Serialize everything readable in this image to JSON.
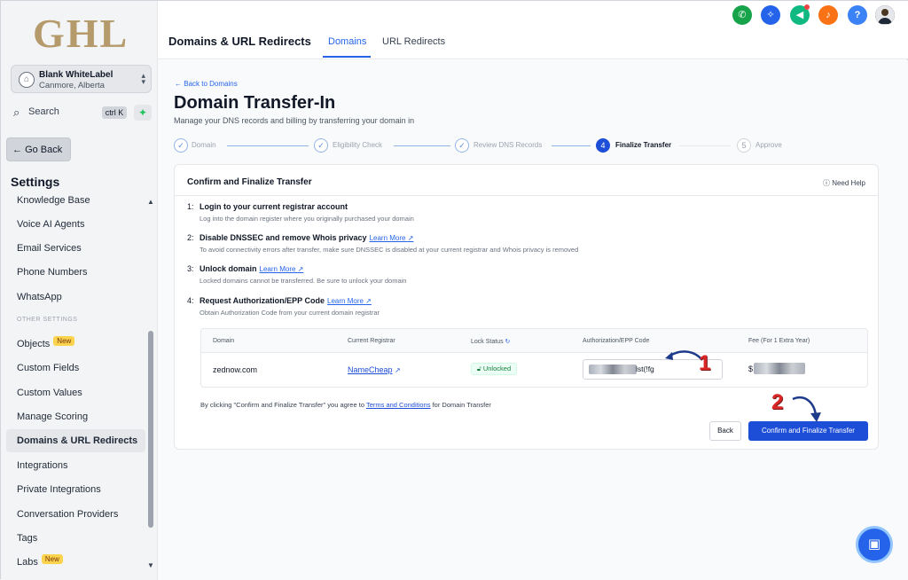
{
  "logo": "GHL",
  "account": {
    "name": "Blank WhiteLabel",
    "location": "Canmore, Alberta"
  },
  "search": {
    "label": "Search",
    "shortcut": "ctrl K"
  },
  "go_back": "Go Back",
  "settings_title": "Settings",
  "nav": {
    "items": [
      {
        "label": "Knowledge Base"
      },
      {
        "label": "Voice AI Agents"
      },
      {
        "label": "Email Services"
      },
      {
        "label": "Phone Numbers"
      },
      {
        "label": "WhatsApp"
      },
      {
        "label": "Objects",
        "badge": "New"
      },
      {
        "label": "Custom Fields"
      },
      {
        "label": "Custom Values"
      },
      {
        "label": "Manage Scoring"
      },
      {
        "label": "Domains & URL Redirects",
        "active": true
      },
      {
        "label": "Integrations"
      },
      {
        "label": "Private Integrations"
      },
      {
        "label": "Conversation Providers"
      },
      {
        "label": "Tags"
      },
      {
        "label": "Labs",
        "badge": "New"
      }
    ],
    "section_other": "OTHER SETTINGS"
  },
  "header": {
    "title": "Domains & URL Redirects",
    "tabs": [
      {
        "label": "Domains",
        "active": true
      },
      {
        "label": "URL Redirects"
      }
    ]
  },
  "toolbar_icons": [
    {
      "name": "phone-icon",
      "color": "#16a34a"
    },
    {
      "name": "magic-icon",
      "color": "#2563eb"
    },
    {
      "name": "megaphone-icon",
      "color": "#10b981"
    },
    {
      "name": "bell-icon",
      "color": "#f97316"
    },
    {
      "name": "help-icon",
      "color": "#3b82f6"
    }
  ],
  "main": {
    "back_link": "Back to Domains",
    "title": "Domain Transfer-In",
    "subtitle": "Manage your DNS records and billing by transferring your domain in",
    "steps": [
      {
        "label": "Domain",
        "state": "done"
      },
      {
        "label": "Eligibility Check",
        "state": "done"
      },
      {
        "label": "Review DNS Records",
        "state": "done"
      },
      {
        "label": "Finalize Transfer",
        "state": "current",
        "number": "4"
      },
      {
        "label": "Approve",
        "state": "todo",
        "number": "5"
      }
    ]
  },
  "card": {
    "title": "Confirm and Finalize Transfer",
    "need_help": "Need Help",
    "instructions": [
      {
        "num": "1:",
        "title": "Login to your current registrar account",
        "desc": "Log into the domain register where you originally purchased your domain"
      },
      {
        "num": "2:",
        "title": "Disable DNSSEC and remove Whois privacy",
        "link": "Learn More",
        "desc": "To avoid connectivity errors after transfer, make sure DNSSEC is disabled at your current registrar and Whois privacy is removed"
      },
      {
        "num": "3:",
        "title": "Unlock domain",
        "link": "Learn More",
        "desc": "Locked domains cannot be transferred. Be sure to unlock your domain"
      },
      {
        "num": "4:",
        "title": "Request Authorization/EPP Code",
        "link": "Learn More",
        "desc": "Obtain Authorization Code from your current domain registrar"
      }
    ],
    "table": {
      "headers": [
        "Domain",
        "Current Registrar",
        "Lock Status",
        "Authorization/EPP Code",
        "Fee (For 1 Extra Year)"
      ],
      "row": {
        "domain": "zednow.com",
        "registrar": "NameCheap",
        "lock_status": "Unlocked",
        "auth_code_visible": "lst(!fg",
        "fee_prefix": "$"
      }
    },
    "terms_prefix": "By clicking \"Confirm and Finalize Transfer\" you agree to",
    "terms_link": "Terms and Conditions",
    "terms_suffix": "for Domain Transfer",
    "back_button": "Back",
    "confirm_button": "Confirm and Finalize Transfer"
  },
  "annotations": [
    "1",
    "2"
  ]
}
